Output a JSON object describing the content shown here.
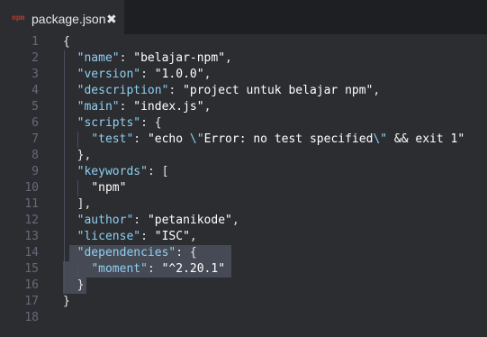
{
  "tab": {
    "icon": "npm",
    "title": "package.json",
    "close_glyph": "✖"
  },
  "editor": {
    "lines": [
      {
        "num": "1",
        "tokens": [
          [
            "p",
            "{"
          ]
        ]
      },
      {
        "num": "2",
        "tokens": [
          [
            "p",
            "  "
          ],
          [
            "k",
            "\"name\""
          ],
          [
            "p",
            ": "
          ],
          [
            "s",
            "\"belajar-npm\""
          ],
          [
            "p",
            ","
          ]
        ]
      },
      {
        "num": "3",
        "tokens": [
          [
            "p",
            "  "
          ],
          [
            "k",
            "\"version\""
          ],
          [
            "p",
            ": "
          ],
          [
            "s",
            "\"1.0.0\""
          ],
          [
            "p",
            ","
          ]
        ]
      },
      {
        "num": "4",
        "tokens": [
          [
            "p",
            "  "
          ],
          [
            "k",
            "\"description\""
          ],
          [
            "p",
            ": "
          ],
          [
            "s",
            "\"project untuk belajar npm\""
          ],
          [
            "p",
            ","
          ]
        ]
      },
      {
        "num": "5",
        "tokens": [
          [
            "p",
            "  "
          ],
          [
            "k",
            "\"main\""
          ],
          [
            "p",
            ": "
          ],
          [
            "s",
            "\"index.js\""
          ],
          [
            "p",
            ","
          ]
        ]
      },
      {
        "num": "6",
        "tokens": [
          [
            "p",
            "  "
          ],
          [
            "k",
            "\"scripts\""
          ],
          [
            "p",
            ": {"
          ]
        ]
      },
      {
        "num": "7",
        "tokens": [
          [
            "p",
            "    "
          ],
          [
            "k",
            "\"test\""
          ],
          [
            "p",
            ": "
          ],
          [
            "s",
            "\"echo "
          ],
          [
            "esc",
            "\\\""
          ],
          [
            "s",
            "Error: no test specified"
          ],
          [
            "esc",
            "\\\""
          ],
          [
            "s",
            " && exit 1\""
          ]
        ]
      },
      {
        "num": "8",
        "tokens": [
          [
            "p",
            "  },"
          ]
        ]
      },
      {
        "num": "9",
        "tokens": [
          [
            "p",
            "  "
          ],
          [
            "k",
            "\"keywords\""
          ],
          [
            "p",
            ": ["
          ]
        ]
      },
      {
        "num": "10",
        "tokens": [
          [
            "p",
            "    "
          ],
          [
            "s",
            "\"npm\""
          ]
        ]
      },
      {
        "num": "11",
        "tokens": [
          [
            "p",
            "  ],"
          ]
        ]
      },
      {
        "num": "12",
        "tokens": [
          [
            "p",
            "  "
          ],
          [
            "k",
            "\"author\""
          ],
          [
            "p",
            ": "
          ],
          [
            "s",
            "\"petanikode\""
          ],
          [
            "p",
            ","
          ]
        ]
      },
      {
        "num": "13",
        "tokens": [
          [
            "p",
            "  "
          ],
          [
            "k",
            "\"license\""
          ],
          [
            "p",
            ": "
          ],
          [
            "s",
            "\"ISC\""
          ],
          [
            "p",
            ","
          ]
        ]
      },
      {
        "num": "14",
        "tokens": [
          [
            "p",
            "  "
          ],
          [
            "k",
            "\"dependencies\""
          ],
          [
            "p",
            ": {"
          ]
        ]
      },
      {
        "num": "15",
        "tokens": [
          [
            "p",
            "    "
          ],
          [
            "k",
            "\"moment\""
          ],
          [
            "p",
            ": "
          ],
          [
            "s",
            "\"^2.20.1\""
          ]
        ]
      },
      {
        "num": "16",
        "tokens": [
          [
            "p",
            "  }"
          ]
        ]
      },
      {
        "num": "17",
        "tokens": [
          [
            "p",
            "}"
          ]
        ]
      },
      {
        "num": "18",
        "tokens": []
      }
    ]
  },
  "colors": {
    "background": "#2b2d31",
    "tabbar": "#1e1f22",
    "key": "#8fd0f2",
    "string": "#ffffff",
    "punct": "#e6e6e6",
    "gutter": "#636b78",
    "selection": "#464a55"
  }
}
